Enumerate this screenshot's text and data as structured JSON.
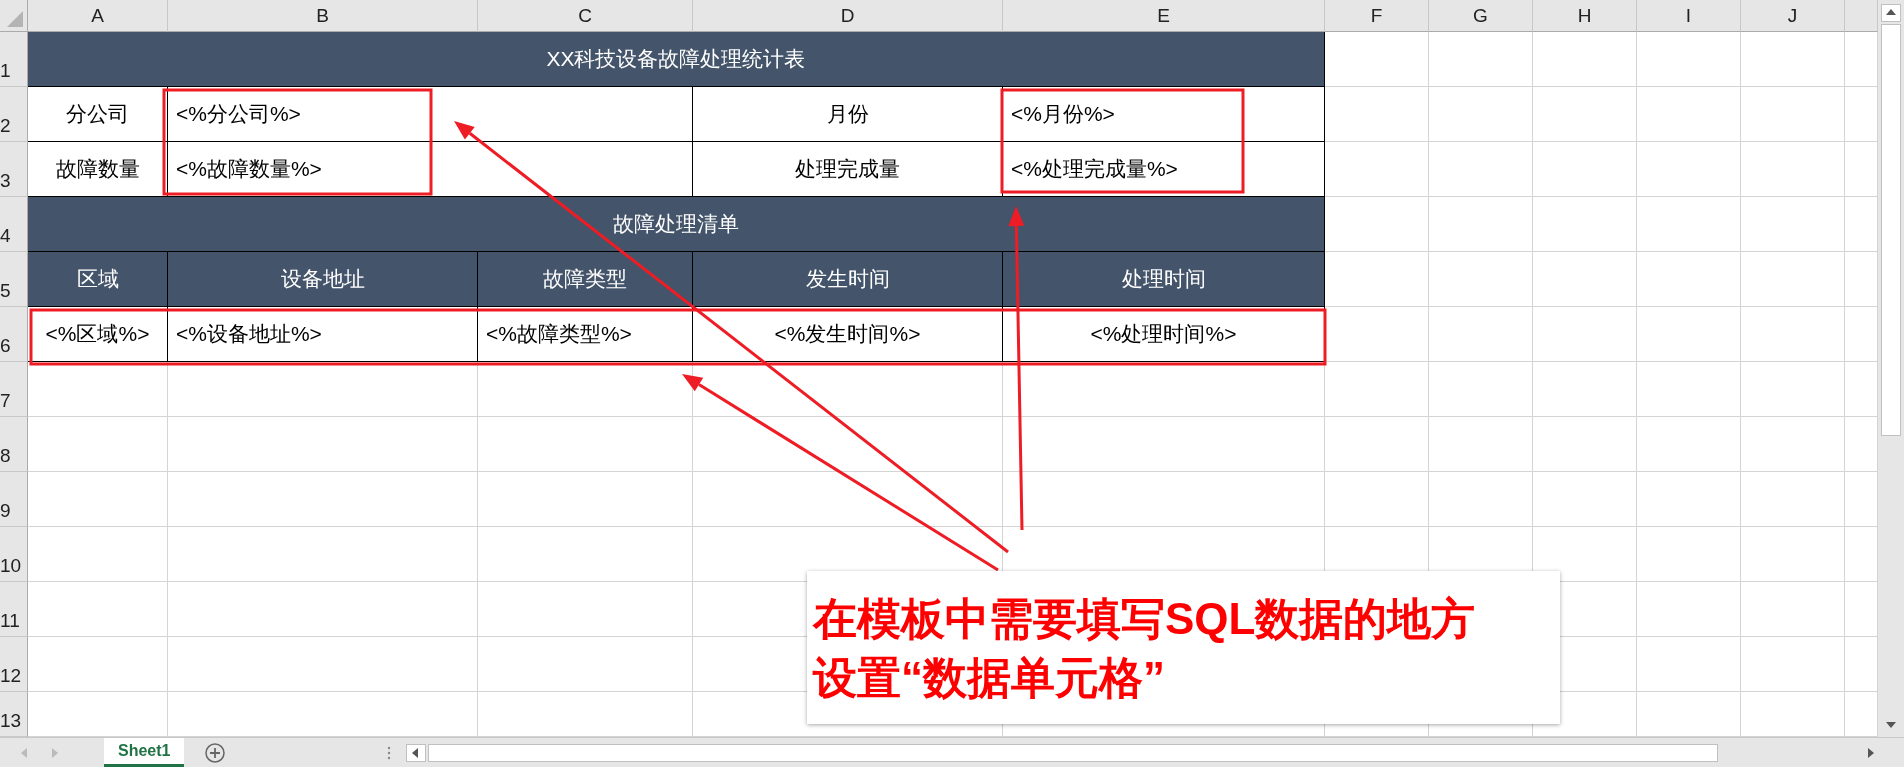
{
  "column_headers": [
    "A",
    "B",
    "C",
    "D",
    "E",
    "F",
    "G",
    "H",
    "I",
    "J"
  ],
  "row_headers": [
    "1",
    "2",
    "3",
    "4",
    "5",
    "6",
    "7",
    "8",
    "9",
    "10",
    "11",
    "12",
    "13"
  ],
  "report": {
    "title": "XX科技设备故障处理统计表",
    "info_rows": [
      {
        "label": "分公司",
        "value": "<%分公司%>",
        "label_2": "月份",
        "value_2": "<%月份%>"
      },
      {
        "label": "故障数量",
        "value": "<%故障数量%>",
        "label_2": "处理完成量",
        "value_2": "<%处理完成量%>"
      }
    ],
    "section_title": "故障处理清单",
    "columns": [
      "区域",
      "设备地址",
      "故障类型",
      "发生时间",
      "处理时间"
    ],
    "data_row": [
      "<%区域%>",
      "<%设备地址%>",
      "<%故障类型%>",
      "<%发生时间%>",
      "<%处理时间%>"
    ]
  },
  "callout": {
    "lines": [
      "在模板中需要填写SQL数据的地方",
      "设置“数据单元格”"
    ]
  },
  "sheet_tabs": [
    {
      "label": "Sheet1",
      "selected": true
    }
  ]
}
